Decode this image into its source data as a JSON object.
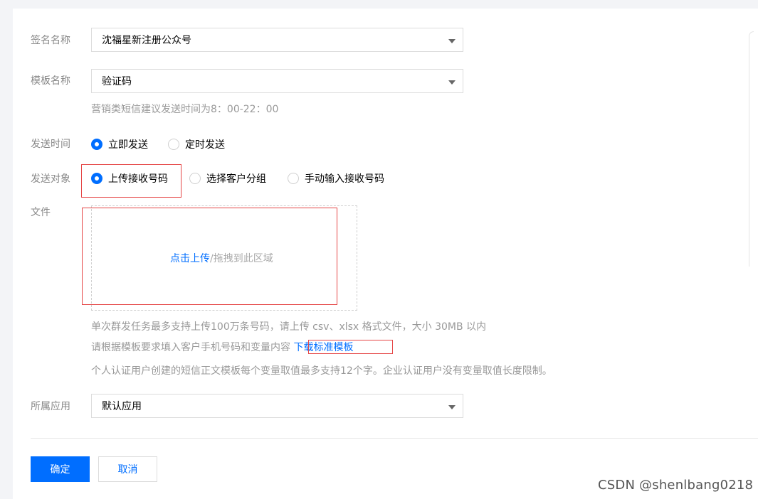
{
  "form": {
    "signature": {
      "label": "签名名称",
      "value": "沈福星新注册公众号"
    },
    "template": {
      "label": "模板名称",
      "value": "验证码",
      "hint": "营销类短信建议发送时间为8：00-22：00"
    },
    "send_time": {
      "label": "发送时间",
      "options": [
        "立即发送",
        "定时发送"
      ],
      "selected": 0
    },
    "send_target": {
      "label": "发送对象",
      "options": [
        "上传接收号码",
        "选择客户分组",
        "手动输入接收号码"
      ],
      "selected": 0
    },
    "file": {
      "label": "文件",
      "upload_link": "点击上传",
      "upload_rest": "/拖拽到此区域",
      "note1": "单次群发任务最多支持上传100万条号码，请上传 csv、xlsx 格式文件，大小 30MB 以内",
      "note2": "请根据模板要求填入客户手机号码和变量内容",
      "download_link": "下载标准模板",
      "note3": "个人认证用户创建的短信正文模板每个变量取值最多支持12个字。企业认证用户没有变量取值长度限制。"
    },
    "app": {
      "label": "所属应用",
      "value": "默认应用"
    }
  },
  "actions": {
    "confirm": "确定",
    "cancel": "取消"
  },
  "watermark": "CSDN @shenlbang0218",
  "colors": {
    "primary": "#006eff",
    "highlight": "#e54545"
  }
}
